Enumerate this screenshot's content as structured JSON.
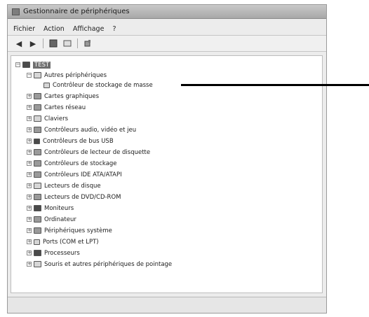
{
  "window": {
    "title": "Gestionnaire de périphériques"
  },
  "menu": [
    "Fichier",
    "Action",
    "Affichage",
    "?"
  ],
  "toolbar_icons": [
    "back-arrow-icon",
    "forward-arrow-icon",
    "tree-view-icon",
    "properties-icon",
    "help-icon",
    "scan-hardware-icon"
  ],
  "tree": {
    "root": "TEST",
    "items": [
      {
        "label": "Autres périphériques",
        "expanded": true,
        "icon": "unknown-device-icon",
        "children": [
          {
            "label": "Contrôleur de stockage de masse",
            "icon": "warning-device-icon"
          }
        ]
      },
      {
        "label": "Cartes graphiques",
        "icon": "display-adapter-icon"
      },
      {
        "label": "Cartes réseau",
        "icon": "network-adapter-icon"
      },
      {
        "label": "Claviers",
        "icon": "keyboard-icon"
      },
      {
        "label": "Contrôleurs audio, vidéo et jeu",
        "icon": "sound-icon"
      },
      {
        "label": "Contrôleurs de bus USB",
        "icon": "usb-icon"
      },
      {
        "label": "Contrôleurs de lecteur de disquette",
        "icon": "floppy-controller-icon"
      },
      {
        "label": "Contrôleurs de stockage",
        "icon": "storage-controller-icon"
      },
      {
        "label": "Contrôleurs IDE ATA/ATAPI",
        "icon": "ide-controller-icon"
      },
      {
        "label": "Lecteurs de disque",
        "icon": "disk-drive-icon"
      },
      {
        "label": "Lecteurs de DVD/CD-ROM",
        "icon": "dvd-drive-icon"
      },
      {
        "label": "Moniteurs",
        "icon": "monitor-icon"
      },
      {
        "label": "Ordinateur",
        "icon": "computer-icon"
      },
      {
        "label": "Périphériques système",
        "icon": "system-device-icon"
      },
      {
        "label": "Ports (COM et LPT)",
        "icon": "port-icon"
      },
      {
        "label": "Processeurs",
        "icon": "processor-icon"
      },
      {
        "label": "Souris et autres périphériques de pointage",
        "icon": "mouse-icon"
      }
    ]
  }
}
